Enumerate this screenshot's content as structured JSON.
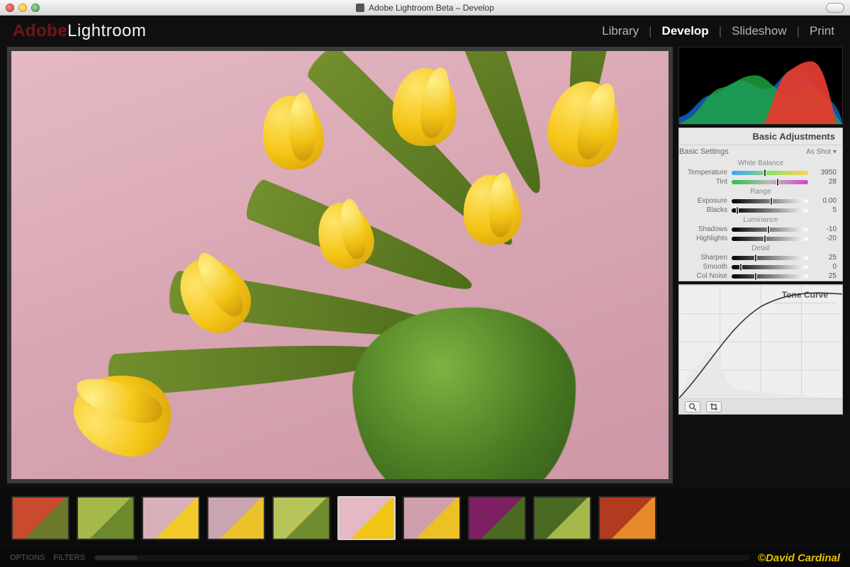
{
  "window": {
    "title": "Adobe Lightroom Beta – Develop"
  },
  "brand": {
    "adobe": "Adobe",
    "product": "Lightroom"
  },
  "modules": {
    "items": [
      "Library",
      "Develop",
      "Slideshow",
      "Print"
    ],
    "active_index": 1
  },
  "panels": {
    "basic": {
      "title": "Basic Adjustments",
      "settings_label": "Basic Settings",
      "mode": "As Shot ▾",
      "groups": {
        "white_balance": "White Balance",
        "range": "Range",
        "luminance": "Luminance",
        "detail": "Detail"
      },
      "sliders": {
        "temperature": {
          "label": "Temperature",
          "value": "3950",
          "pos": 0.42
        },
        "tint": {
          "label": "Tint",
          "value": "28",
          "pos": 0.58
        },
        "exposure": {
          "label": "Exposure",
          "value": "0.00",
          "pos": 0.5
        },
        "blacks": {
          "label": "Blacks",
          "value": "5",
          "pos": 0.06
        },
        "shadows": {
          "label": "Shadows",
          "value": "-10",
          "pos": 0.46
        },
        "highlights": {
          "label": "Highlights",
          "value": "-20",
          "pos": 0.42
        },
        "sharpen": {
          "label": "Sharpen",
          "value": "25",
          "pos": 0.3
        },
        "smooth": {
          "label": "Smooth",
          "value": "0",
          "pos": 0.1
        },
        "colornoise": {
          "label": "Col Noise",
          "value": "25",
          "pos": 0.3
        }
      }
    },
    "tone_curve": {
      "title": "Tone Curve"
    }
  },
  "subtools": {
    "zoom_icon": "zoom",
    "crop_icon": "crop"
  },
  "filmstrip": {
    "count": 10,
    "selected_index": 5,
    "palettes": [
      [
        "#c94a2f",
        "#6a7a2a"
      ],
      [
        "#a5b84a",
        "#6e8a2e"
      ],
      [
        "#d9b0ba",
        "#f0c92a"
      ],
      [
        "#caa5b0",
        "#eac22a"
      ],
      [
        "#b6c45a",
        "#6f8c2e"
      ],
      [
        "#e4b9c3",
        "#f2c516"
      ],
      [
        "#cfa0ac",
        "#eec028"
      ],
      [
        "#7d1f62",
        "#4a6a22"
      ],
      [
        "#4a6a22",
        "#a5b84a"
      ],
      [
        "#b23a1f",
        "#e68a2a"
      ]
    ]
  },
  "statusbar": {
    "options": "OPTIONS",
    "filters": "FILTERS"
  },
  "credit": "©David Cardinal"
}
